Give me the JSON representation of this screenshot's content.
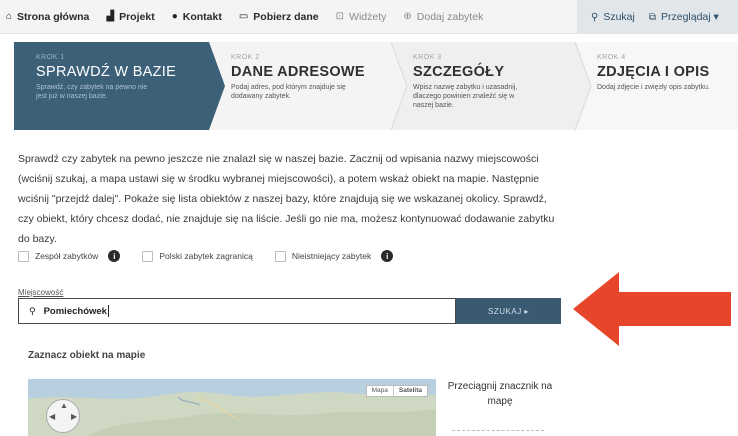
{
  "nav": {
    "items": [
      {
        "label": "Strona główna",
        "icon": "home-icon",
        "glyph": "⌂"
      },
      {
        "label": "Projekt",
        "icon": "chart-icon",
        "glyph": "▟"
      },
      {
        "label": "Kontakt",
        "icon": "chat-icon",
        "glyph": "●"
      },
      {
        "label": "Pobierz dane",
        "icon": "download-icon",
        "glyph": "▭"
      },
      {
        "label": "Widżety",
        "icon": "widget-icon",
        "glyph": "⊡"
      },
      {
        "label": "Dodaj zabytek",
        "icon": "add-icon",
        "glyph": "⊕"
      }
    ],
    "right": [
      {
        "label": "Szukaj",
        "icon": "search-icon",
        "glyph": "⚲"
      },
      {
        "label": "Przeglądaj ▾",
        "icon": "browse-icon",
        "glyph": "⧉"
      }
    ]
  },
  "steps": [
    {
      "num": "KROK 1",
      "title": "SPRAWDŹ W BAZIE",
      "desc": "Sprawdź, czy zabytek na pewno nie jest już w naszej bazie."
    },
    {
      "num": "KROK 2",
      "title": "DANE ADRESOWE",
      "desc": "Podaj adres, pod którym znajduje się dodawany zabytek."
    },
    {
      "num": "KROK 3",
      "title": "SZCZEGÓŁY",
      "desc": "Wpisz nazwę zabytku i uzasadnij, dlaczego powinien znaleźć się w naszej bazie."
    },
    {
      "num": "KROK 4",
      "title": "ZDJĘCIA I OPIS",
      "desc": "Dodaj zdjęcie i zwięzły opis zabytku."
    }
  ],
  "intro": "Sprawdź czy zabytek na pewno jeszcze nie znalazł się w naszej bazie. Zacznij od wpisania nazwy miejscowości (wciśnij szukaj, a mapa ustawi się w środku wybranej miejscowości), a potem wskaż obiekt na mapie. Następnie wciśnij \"przejdź dalej\". Pokaże się lista obiektów z naszej bazy, które znajdują się we wskazanej okolicy. Sprawdź, czy obiekt, który chcesz dodać, nie znajduje się na liście. Jeśli go nie ma, możesz kontynuować dodawanie zabytku do bazy.",
  "checkboxes": [
    {
      "label": "Zespół zabytków",
      "info": "i"
    },
    {
      "label": "Polski zabytek zagranicą",
      "info": ""
    },
    {
      "label": "Nieistniejący zabytek",
      "info": "i"
    }
  ],
  "search": {
    "label": "Miejscowość",
    "value": "Pomiechówek",
    "button": "SZUKAJ ▸"
  },
  "map": {
    "heading": "Zaznacz obiekt na mapie",
    "toggle": [
      "Mapa",
      "Satelita"
    ],
    "drag_hint": "Przeciągnij znacznik na mapę"
  },
  "colors": {
    "accent": "#3d6079",
    "arrow": "#e8462a"
  }
}
